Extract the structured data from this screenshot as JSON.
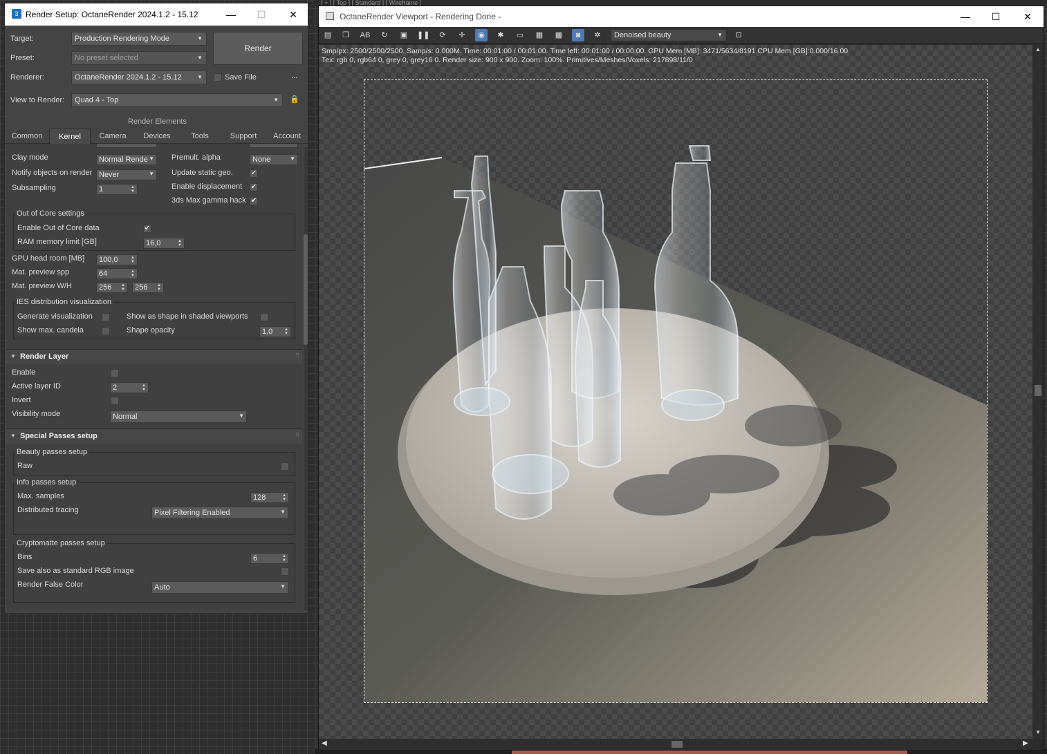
{
  "background": {
    "viewport_labels": "[ + ] [ Top ] [ Standard ] [ Wireframe ]"
  },
  "render_setup": {
    "app_icon": "3",
    "title": "Render Setup: OctaneRender 2024.1.2 - 15.12",
    "target_label": "Target:",
    "target_value": "Production Rendering Mode",
    "preset_label": "Preset:",
    "preset_value": "No preset selected",
    "renderer_label": "Renderer:",
    "renderer_value": "OctaneRender 2024.1.2 - 15.12",
    "save_file_label": "Save File",
    "more_label": "...",
    "view_label": "View to Render:",
    "view_value": "Quad 4 - Top",
    "render_button": "Render",
    "render_elements": "Render Elements",
    "tabs": [
      "Common",
      "Kernel",
      "Camera",
      "Devices",
      "Tools",
      "Support",
      "Account"
    ],
    "active_tab": "Kernel",
    "kernel": {
      "clay_mode_label": "Clay mode",
      "clay_mode_value": "Normal Rende",
      "premult_label": "Premult. alpha",
      "premult_value": "None",
      "notify_label": "Notify objects on render",
      "notify_value": "Never",
      "update_static_label": "Update static geo.",
      "subsampling_label": "Subsampling",
      "subsampling_value": "1",
      "enable_disp_label": "Enable displacement",
      "gamma_hack_label": "3ds Max gamma hack",
      "ooc_title": "Out of Core settings",
      "ooc_enable_label": "Enable Out of Core data",
      "ram_label": "RAM memory limit [GB]",
      "ram_value": "16,0",
      "gpu_headroom_label": "GPU head room [MB]",
      "gpu_headroom_value": "100,0",
      "mat_spp_label": "Mat. preview spp",
      "mat_spp_value": "64",
      "mat_wh_label": "Mat. preview W/H",
      "mat_w_value": "256",
      "mat_h_value": "256",
      "ies_title": "IES distribution visualization",
      "gen_vis_label": "Generate visualization",
      "show_shape_label": "Show as shape in shaded viewports",
      "show_candela_label": "Show max. candela",
      "shape_opacity_label": "Shape opacity",
      "shape_opacity_value": "1,0"
    },
    "render_layer": {
      "title": "Render Layer",
      "enable_label": "Enable",
      "active_layer_label": "Active layer ID",
      "active_layer_value": "2",
      "invert_label": "Invert",
      "visibility_label": "Visibility mode",
      "visibility_value": "Normal"
    },
    "special_passes": {
      "title": "Special Passes setup",
      "beauty_title": "Beauty passes setup",
      "raw_label": "Raw",
      "info_title": "Info passes setup",
      "max_samples_label": "Max. samples",
      "max_samples_value": "128",
      "dist_tracing_label": "Distributed tracing",
      "dist_tracing_value": "Pixel Filtering Enabled",
      "crypto_title": "Cryptomatte passes setup",
      "bins_label": "Bins",
      "bins_value": "6",
      "save_rgb_label": "Save also as standard RGB image",
      "false_color_label": "Render False Color",
      "false_color_value": "Auto"
    }
  },
  "viewport": {
    "title": "OctaneRender Viewport - Rendering Done -",
    "pass_value": "Denoised beauty",
    "stats_line1": "Smp/px: 2500/2500/2500.   Samp/s: 0.000M.   Time: 00:01:00 / 00:01:00.   Time left: 00:01:00 / 00:00:00.   GPU Mem [MB]: 3471/5634/8191   CPU Mem [GB]:0.000/16.00",
    "stats_line2": "Tex: rgb 0, rgb64 0, grey 0, grey16 0.   Render size: 900 x 900.   Zoom: 100%.   Primitives/Meshes/Voxels: 217898/11/0"
  },
  "glyphs": {
    "minimize": "—",
    "maximize": "☐",
    "close": "✕",
    "check": "✔",
    "dropdown": "▼",
    "lock": "🔒"
  },
  "colors": {
    "accent": "#4c7bb5",
    "panel": "#404040",
    "window": "#444444"
  }
}
